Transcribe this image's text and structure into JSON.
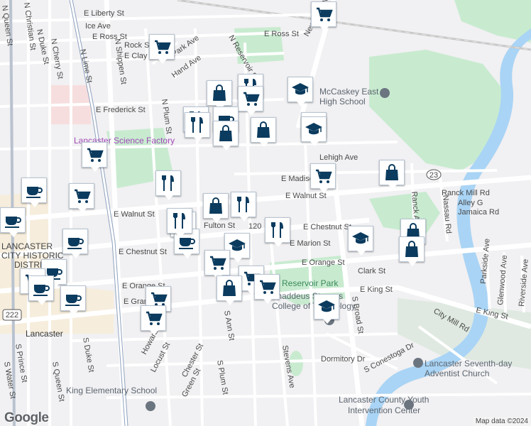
{
  "colors": {
    "pin_icon": "#0b3b5e",
    "water": "#a9d4f5",
    "park": "#c8ebd0",
    "road_major": "#ffffff",
    "highway_outline": "#8ea2bf",
    "poi_purple": "#a04bb8",
    "poi_green": "#3a8a5a",
    "poi_gray": "#5c6670"
  },
  "streets": [
    "E Liberty St",
    "Ice Ave",
    "E Ross St",
    "Rock St",
    "E Clay St",
    "Park Ave",
    "Hand Ave",
    "E Frederick St",
    "N Reservoir St",
    "New Holland Ave",
    "N Duke St",
    "N Cherry St",
    "N Shippen St",
    "N Christian St",
    "N Queen St",
    "N Lime St",
    "N Plum St",
    "E Madison St",
    "Lehigh Ave",
    "E Walnut St",
    "E Walnut St",
    "E Chestnut St",
    "E Chestnut St",
    "E Marion St",
    "E Orange St",
    "E Orange St",
    "Clark St",
    "E King St",
    "E King St",
    "E Grant St",
    "Ranck Mill Rd",
    "Alley G",
    "Jamaica Rd",
    "Ranck Ave",
    "Nassau Rd",
    "Parkside Ave",
    "Glenwood Ave",
    "Riverside Ave",
    "City Mill Rd",
    "S Conestoga Dr",
    "Dormitory Dr",
    "S Broad St",
    "Stevens Ave",
    "S Ann St",
    "S Plum St",
    "Howard Ave",
    "Locust St",
    "Chester St",
    "Green St",
    "S Duke St",
    "S Queen St",
    "S Prince St",
    "S Water St",
    "Fulton St",
    "E Walnut St"
  ],
  "places": [
    "McCaskey East High School",
    "Lancaster Science Factory",
    "Reservoir Park",
    "Thaddeus Stevens College of Technology",
    "Lancaster Seventh-day Adventist Church",
    "Lancaster County Youth Intervention Center",
    "King Elementary School",
    "Lancaster",
    "LANCASTER CITY HISTORIC DISTRICT"
  ],
  "route_shields": [
    "23",
    "222"
  ],
  "house_number": "120",
  "map_labels": {
    "mccaskey": "McCaskey East",
    "mccaskey2": "High School",
    "science": "Lancaster Science Factory",
    "reservoir": "Reservoir Park",
    "thaddeus": "Thaddeus Stevens",
    "thaddeus2": "College of Technology",
    "sda": "Lancaster Seventh-day",
    "sda2": "Adventist Church",
    "youth": "Lancaster County Youth",
    "youth2": "Intervention Center",
    "king": "King Elementary School",
    "lancaster": "Lancaster",
    "lch1": "LANCASTER",
    "lch2": "CITY HISTORIC",
    "lch3": "DISTRICT"
  },
  "markers": [
    {
      "type": "grocery"
    },
    {
      "type": "grocery"
    },
    {
      "type": "shopping"
    },
    {
      "type": "restaurant"
    },
    {
      "type": "grocery"
    },
    {
      "type": "school"
    },
    {
      "type": "restaurant"
    },
    {
      "type": "cafe"
    },
    {
      "type": "restaurant"
    },
    {
      "type": "shopping"
    },
    {
      "type": "shopping"
    },
    {
      "type": "school"
    },
    {
      "type": "school"
    },
    {
      "type": "grocery"
    },
    {
      "type": "shopping"
    },
    {
      "type": "restaurant"
    },
    {
      "type": "cafe"
    },
    {
      "type": "grocery"
    },
    {
      "type": "restaurant"
    },
    {
      "type": "shopping"
    },
    {
      "type": "restaurant"
    },
    {
      "type": "cafe"
    },
    {
      "type": "grocery"
    },
    {
      "type": "cafe"
    },
    {
      "type": "school"
    },
    {
      "type": "restaurant"
    },
    {
      "type": "shopping"
    },
    {
      "type": "cafe"
    },
    {
      "type": "school"
    },
    {
      "type": "grocery"
    },
    {
      "type": "cafe"
    },
    {
      "type": "grocery"
    },
    {
      "type": "grocery"
    },
    {
      "type": "cafe"
    },
    {
      "type": "cafe"
    },
    {
      "type": "shopping"
    },
    {
      "type": "grocery"
    },
    {
      "type": "grocery"
    },
    {
      "type": "shopping"
    },
    {
      "type": "school"
    },
    {
      "type": "grocery"
    },
    {
      "type": "grocery"
    }
  ],
  "branding": {
    "logo": "Google",
    "attribution": "Map data ©2024"
  }
}
